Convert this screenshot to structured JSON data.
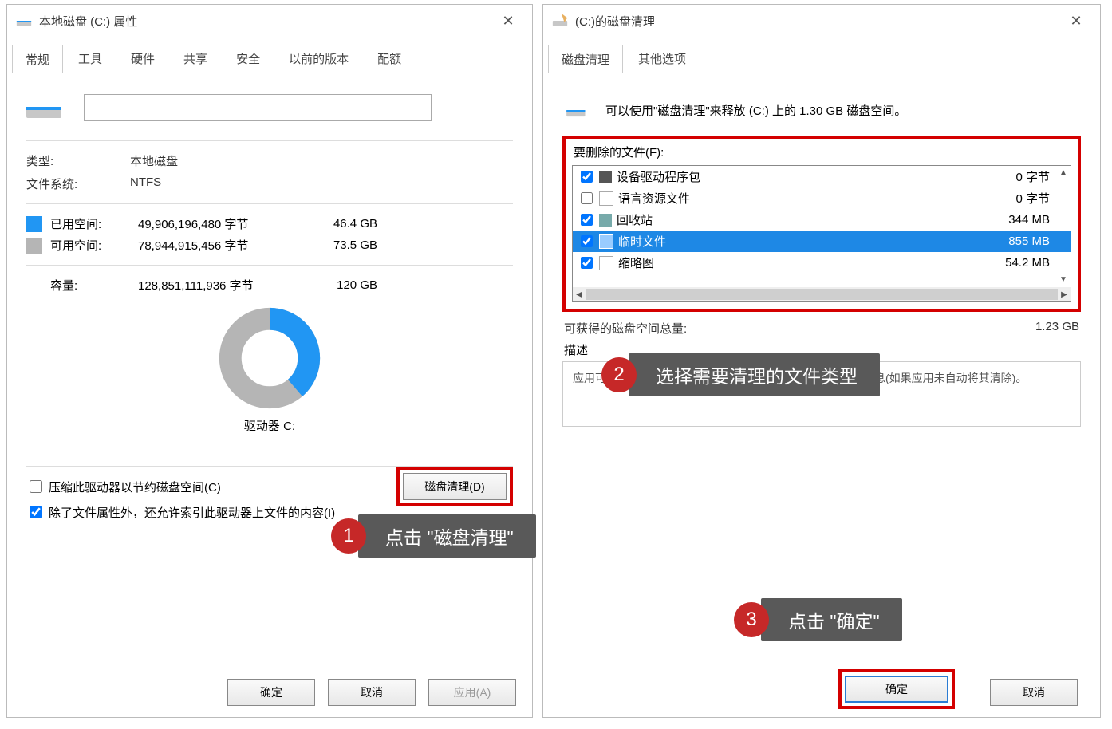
{
  "leftDialog": {
    "title": "本地磁盘 (C:) 属性",
    "tabs": [
      "常规",
      "工具",
      "硬件",
      "共享",
      "安全",
      "以前的版本",
      "配额"
    ],
    "type_label": "类型:",
    "type_value": "本地磁盘",
    "fs_label": "文件系统:",
    "fs_value": "NTFS",
    "used_label": "已用空间:",
    "used_bytes": "49,906,196,480 字节",
    "used_gb": "46.4 GB",
    "free_label": "可用空间:",
    "free_bytes": "78,944,915,456 字节",
    "free_gb": "73.5 GB",
    "cap_label": "容量:",
    "cap_bytes": "128,851,111,936 字节",
    "cap_gb": "120 GB",
    "drive_label": "驱动器 C:",
    "cleanup_btn": "磁盘清理(D)",
    "compress_cb": "压缩此驱动器以节约磁盘空间(C)",
    "index_cb": "除了文件属性外，还允许索引此驱动器上文件的内容(I)",
    "ok": "确定",
    "cancel": "取消",
    "apply": "应用(A)"
  },
  "rightDialog": {
    "title": "(C:)的磁盘清理",
    "tabs": [
      "磁盘清理",
      "其他选项"
    ],
    "info": "可以使用\"磁盘清理\"来释放  (C:) 上的 1.30 GB 磁盘空间。",
    "files_label": "要删除的文件(F):",
    "items": [
      {
        "checked": true,
        "name": "设备驱动程序包",
        "size": "0 字节"
      },
      {
        "checked": false,
        "name": "语言资源文件",
        "size": "0 字节"
      },
      {
        "checked": true,
        "name": "回收站",
        "size": "344 MB"
      },
      {
        "checked": true,
        "name": "临时文件",
        "size": "855 MB",
        "selected": true
      },
      {
        "checked": true,
        "name": "缩略图",
        "size": "54.2 MB"
      }
    ],
    "gain_label": "可获得的磁盘空间总量:",
    "gain_value": "1.23 GB",
    "desc_label": "描述",
    "desc_text": "应用可以在特定文件夹中存储临时信息。可以手动清除这些信息(如果应用未自动将其清除)。",
    "ok": "确定",
    "cancel": "取消"
  },
  "callouts": {
    "c1": "点击 \"磁盘清理\"",
    "c2": "选择需要清理的文件类型",
    "c3": "点击 \"确定\""
  },
  "chart_data": {
    "type": "pie",
    "title": "",
    "series": [
      {
        "name": "已用空间",
        "value": 46.4,
        "unit": "GB",
        "color": "#2196f3"
      },
      {
        "name": "可用空间",
        "value": 73.5,
        "unit": "GB",
        "color": "#b5b5b5"
      }
    ]
  }
}
